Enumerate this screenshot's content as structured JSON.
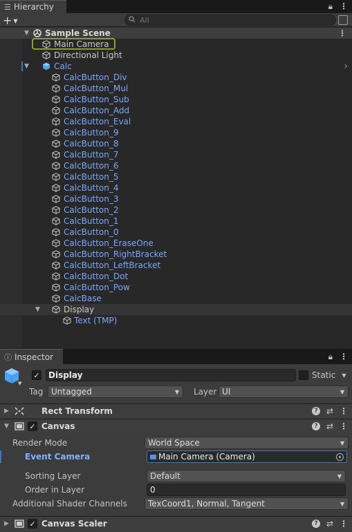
{
  "hierarchy": {
    "tab_label": "Hierarchy",
    "search_placeholder": "All",
    "add_button": "+",
    "scene_name": "Sample Scene",
    "items": [
      {
        "label": "Main Camera",
        "indent": 1,
        "style": "gray"
      },
      {
        "label": "Directional Light",
        "indent": 1,
        "style": "gray"
      },
      {
        "label": "Calc",
        "indent": 1,
        "style": "blue",
        "expanded": true
      },
      {
        "label": "CalcButton_Div",
        "indent": 2,
        "style": "blue"
      },
      {
        "label": "CalcButton_Mul",
        "indent": 2,
        "style": "blue"
      },
      {
        "label": "CalcButton_Sub",
        "indent": 2,
        "style": "blue"
      },
      {
        "label": "CalcButton_Add",
        "indent": 2,
        "style": "blue"
      },
      {
        "label": "CalcButton_Eval",
        "indent": 2,
        "style": "blue"
      },
      {
        "label": "CalcButton_9",
        "indent": 2,
        "style": "blue"
      },
      {
        "label": "CalcButton_8",
        "indent": 2,
        "style": "blue"
      },
      {
        "label": "CalcButton_7",
        "indent": 2,
        "style": "blue"
      },
      {
        "label": "CalcButton_6",
        "indent": 2,
        "style": "blue"
      },
      {
        "label": "CalcButton_5",
        "indent": 2,
        "style": "blue"
      },
      {
        "label": "CalcButton_4",
        "indent": 2,
        "style": "blue"
      },
      {
        "label": "CalcButton_3",
        "indent": 2,
        "style": "blue"
      },
      {
        "label": "CalcButton_2",
        "indent": 2,
        "style": "blue"
      },
      {
        "label": "CalcButton_1",
        "indent": 2,
        "style": "blue"
      },
      {
        "label": "CalcButton_0",
        "indent": 2,
        "style": "blue"
      },
      {
        "label": "CalcButton_EraseOne",
        "indent": 2,
        "style": "blue"
      },
      {
        "label": "CalcButton_RightBracket",
        "indent": 2,
        "style": "blue"
      },
      {
        "label": "CalcButton_LeftBracket",
        "indent": 2,
        "style": "blue"
      },
      {
        "label": "CalcButton_Dot",
        "indent": 2,
        "style": "blue"
      },
      {
        "label": "CalcButton_Pow",
        "indent": 2,
        "style": "blue"
      },
      {
        "label": "CalcBase",
        "indent": 2,
        "style": "blue"
      },
      {
        "label": "Display",
        "indent": 2,
        "style": "gray",
        "expanded": true
      },
      {
        "label": "Text (TMP)",
        "indent": 3,
        "style": "blue"
      }
    ]
  },
  "inspector": {
    "tab_label": "Inspector",
    "object_name": "Display",
    "static_label": "Static",
    "tag_label": "Tag",
    "tag_value": "Untagged",
    "layer_label": "Layer",
    "layer_value": "UI",
    "components": {
      "rect_transform": "Rect Transform",
      "canvas": "Canvas",
      "canvas_scaler": "Canvas Scaler"
    },
    "canvas_fields": {
      "render_mode_label": "Render Mode",
      "render_mode_value": "World Space",
      "event_camera_label": "Event Camera",
      "event_camera_value": "Main Camera (Camera)",
      "sorting_layer_label": "Sorting Layer",
      "sorting_layer_value": "Default",
      "order_in_layer_label": "Order in Layer",
      "order_in_layer_value": "0",
      "shader_channels_label": "Additional Shader Channels",
      "shader_channels_value": "TexCoord1, Normal, Tangent"
    }
  },
  "colors": {
    "prefab_blue": "#7ba7ff",
    "selection_outline": "#8f9a3a",
    "accent_blue": "#3a79bb"
  }
}
